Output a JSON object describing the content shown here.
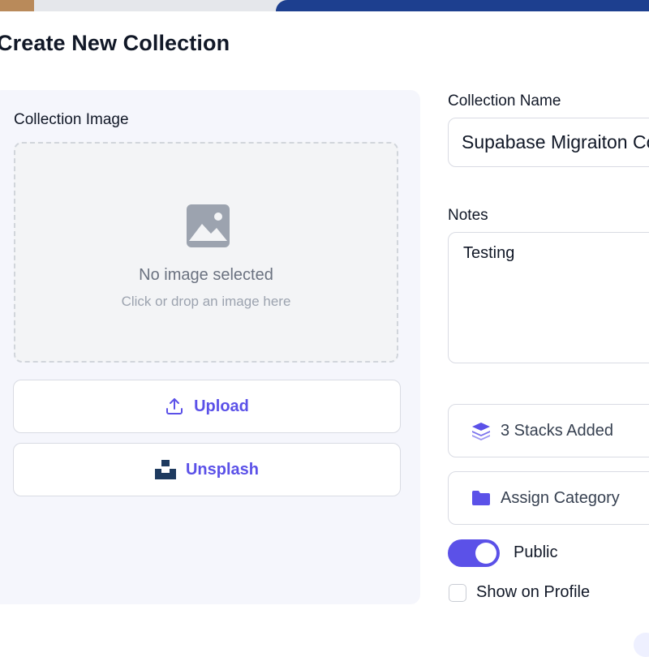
{
  "modal": {
    "title": "Create New Collection"
  },
  "image_section": {
    "label": "Collection Image",
    "empty_title": "No image selected",
    "empty_subtitle": "Click or drop an image here",
    "upload_label": "Upload",
    "unsplash_label": "Unsplash"
  },
  "form": {
    "name_label": "Collection Name",
    "name_value": "Supabase Migraiton Collection",
    "notes_label": "Notes",
    "notes_value": "Testing",
    "stacks_label": "3 Stacks Added",
    "category_label": "Assign Category",
    "public_label": "Public",
    "public_enabled": true,
    "show_on_profile_label": "Show on Profile",
    "show_on_profile_checked": false
  },
  "icons": {
    "image_placeholder": "image-icon",
    "upload": "upload-icon",
    "unsplash": "unsplash-logo-icon",
    "stacks": "layers-icon",
    "category": "folder-icon"
  },
  "colors": {
    "accent": "#5b51e8",
    "panel_bg": "#f5f6fc",
    "icon_gray": "#9ca3af"
  }
}
